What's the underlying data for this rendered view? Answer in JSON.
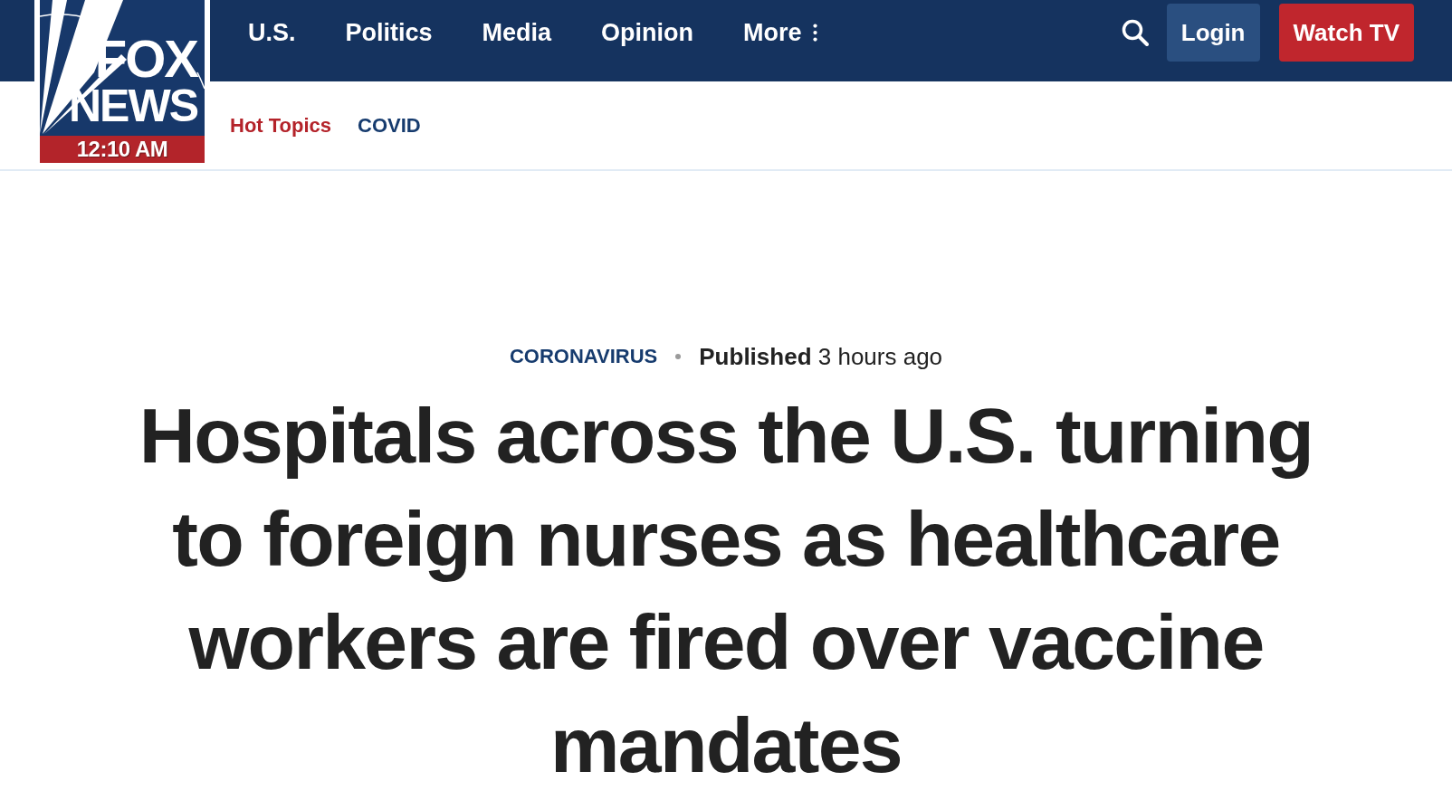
{
  "logo": {
    "line_1": "FOX",
    "line_2": "NEWS",
    "time": "12:10 AM"
  },
  "nav": {
    "items": [
      {
        "label": "U.S.",
        "kind": "link"
      },
      {
        "label": "Politics",
        "kind": "link"
      },
      {
        "label": "Media",
        "kind": "link"
      },
      {
        "label": "Opinion",
        "kind": "link"
      },
      {
        "label": "More",
        "kind": "menu"
      }
    ]
  },
  "buttons": [
    {
      "label": "Login",
      "kind": "secondary"
    },
    {
      "label": "Watch TV",
      "kind": "primary"
    }
  ],
  "subnav": [
    {
      "label": "Hot Topics",
      "color": "#b4232a"
    },
    {
      "label": "COVID",
      "color": "#163b6e"
    }
  ],
  "article": {
    "category": "CORONAVIRUS",
    "published": "**Published** 3 hours ago",
    "headline": "Hospitals across the U.S. turning to foreign nurses as healthcare workers are fired over vaccine mandates"
  }
}
